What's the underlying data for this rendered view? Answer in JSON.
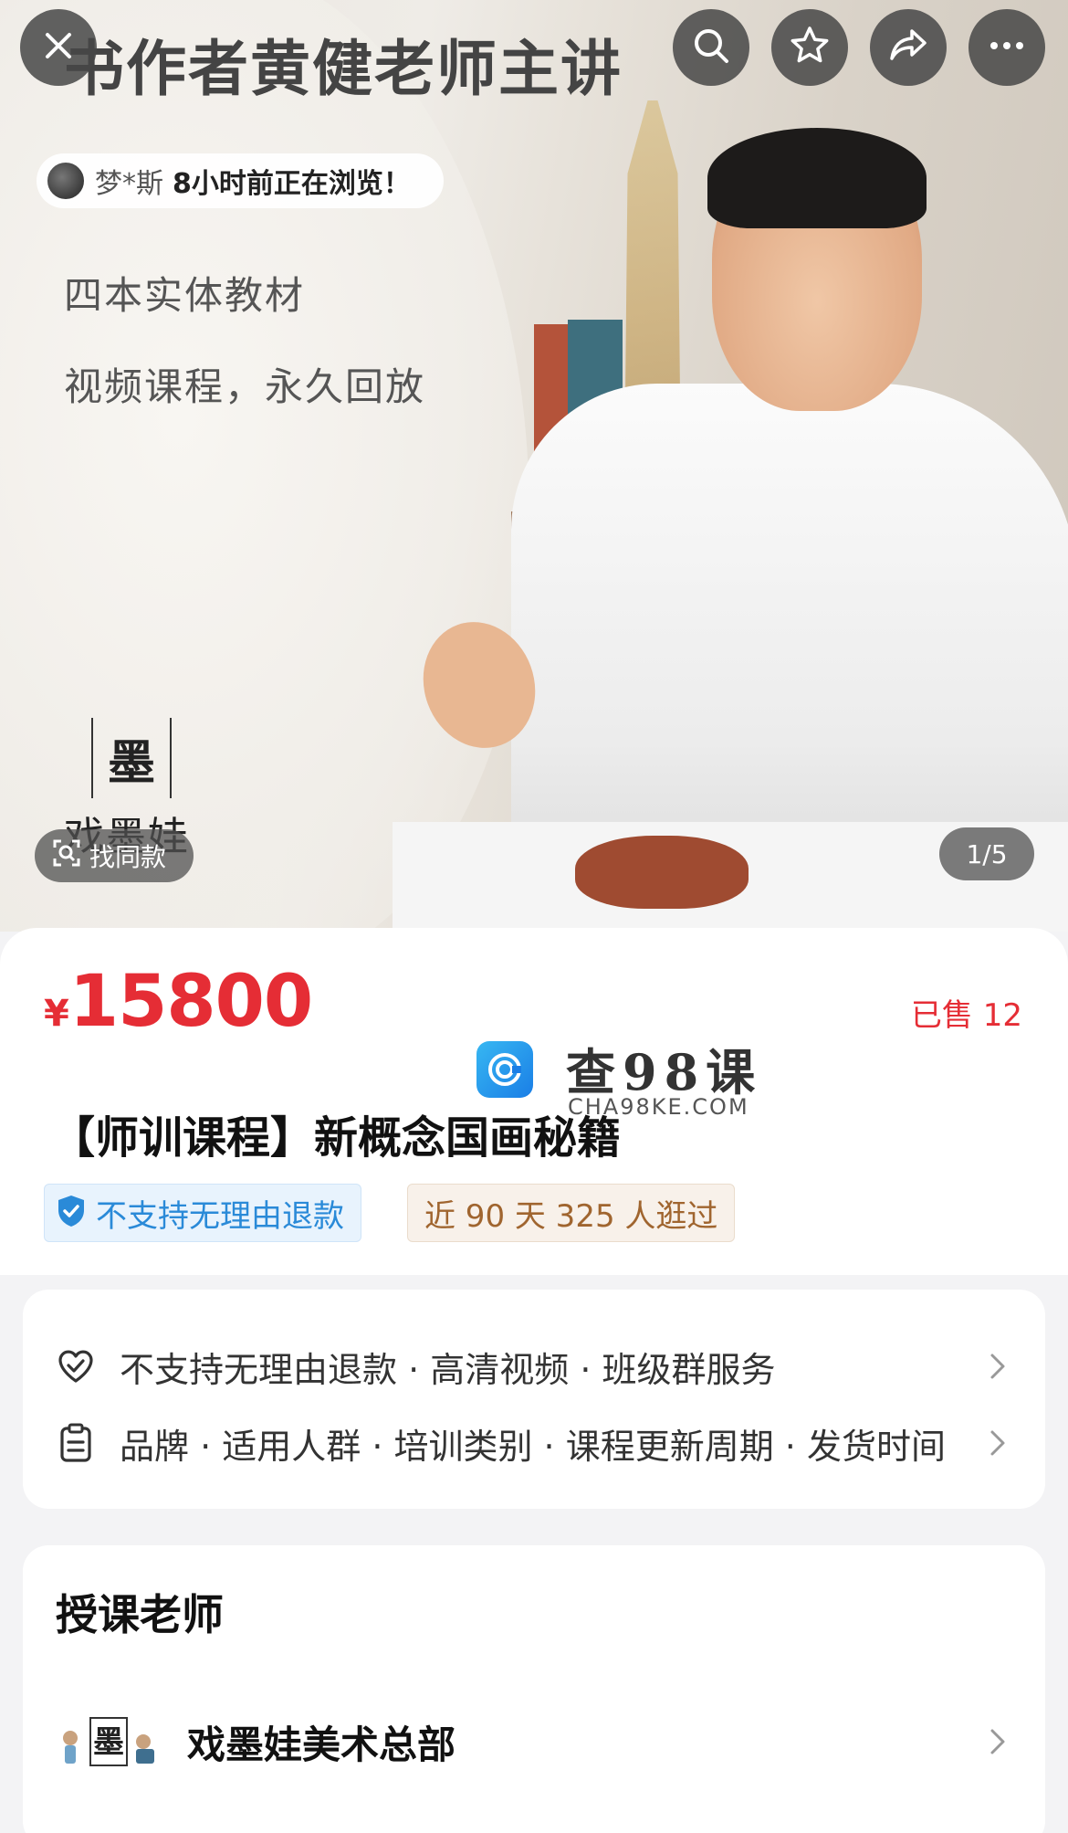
{
  "hero": {
    "title": "书作者黄健老师主讲",
    "viewer": {
      "name": "梦*斯",
      "activity": "8小时前正在浏览！"
    },
    "lines": [
      "四本实体教材",
      "视频课程，永久回放"
    ],
    "brand_mark": "戏墨娃",
    "find_same_label": "找同款",
    "page_indicator": "1/5"
  },
  "toolbar": {
    "icons": [
      "close-icon",
      "search-icon",
      "star-icon",
      "share-icon",
      "more-icon"
    ]
  },
  "product": {
    "currency": "¥",
    "price": "15800",
    "sold": "已售 12",
    "title": "【师训课程】新概念国画秘籍",
    "tags": {
      "refund": "不支持无理由退款",
      "visits": "近 90 天 325 人逛过"
    }
  },
  "watermark": {
    "text": "查98课",
    "sub": "CHA98KE.COM"
  },
  "services": {
    "row1": "不支持无理由退款 · 高清视频 · 班级群服务",
    "row2": "品牌 · 适用人群 · 培训类别 · 课程更新周期 · 发货时间"
  },
  "teacher": {
    "heading": "授课老师",
    "name": "戏墨娃美术总部"
  },
  "colors": {
    "price_red": "#e52d35",
    "refund_blue": "#2a8ad8",
    "visits_brown": "#a0652f",
    "background": "#f3f3f5"
  }
}
